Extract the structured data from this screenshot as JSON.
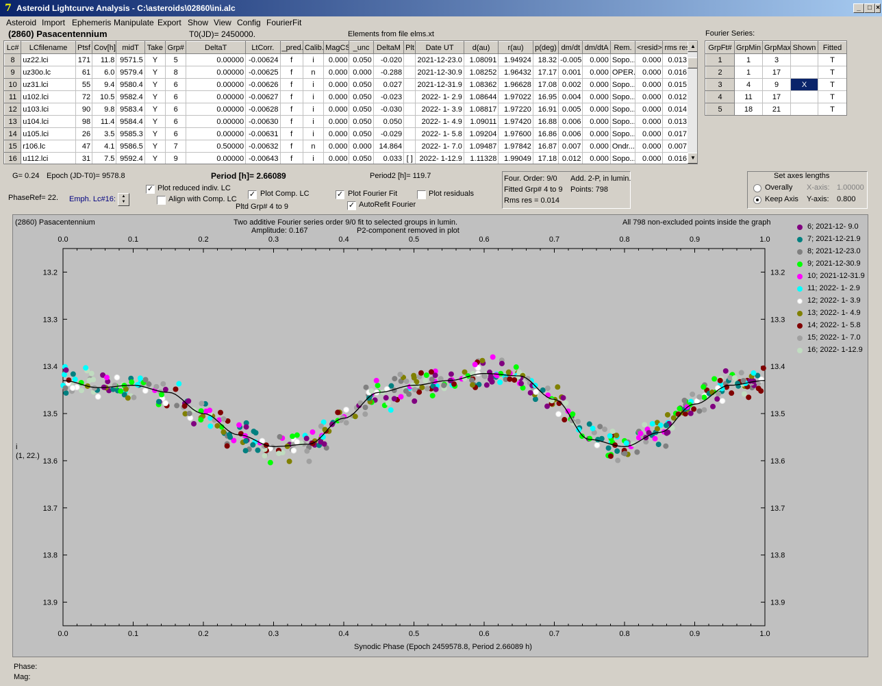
{
  "window": {
    "title": "Asteroid Lightcurve Analysis - C:\\asteroids\\02860\\ini.alc",
    "icon": "app-icon",
    "buttons": [
      "_",
      "□",
      "×"
    ]
  },
  "menu": [
    "Asteroid",
    "Import",
    "Ephemeris",
    "Manipulate",
    "Export",
    "Show",
    "View",
    "Config",
    "FourierFit"
  ],
  "header": {
    "asteroid": "(2860) Pasacentennium",
    "t0": "T0(JD)= 2450000.",
    "elements": "Elements from file elms.xt",
    "fourier_title": "Fourier Series:"
  },
  "lc_table": {
    "columns": [
      "Lc#",
      "LCfilename",
      "Ptsf",
      "Cov[h]",
      "midT",
      "Take",
      "Grp#",
      "DeltaT",
      "LtCorr.",
      "_pred.",
      "Calib.",
      "MagCS",
      "_unc",
      "DeltaM",
      "Plt",
      "Date UT",
      "d(au)",
      "r(au)",
      "p(deg)",
      "dm/dt",
      "dm/dtA",
      "Rem.",
      "<resid>",
      "rms res"
    ],
    "rows": [
      [
        "8",
        "uz22.lci",
        "171",
        "11.8",
        "9571.5",
        "Y",
        "5",
        "0.00000",
        "-0.00624",
        "f",
        "i",
        "0.000",
        "0.050",
        "-0.020",
        "",
        "2021-12-23.0",
        "1.08091",
        "1.94924",
        "18.32",
        "-0.005",
        "0.000",
        "Sopo...",
        "0.000",
        "0.013"
      ],
      [
        "9",
        "uz30o.lc",
        "61",
        "6.0",
        "9579.4",
        "Y",
        "8",
        "0.00000",
        "-0.00625",
        "f",
        "n",
        "0.000",
        "0.000",
        "-0.288",
        "",
        "2021-12-30.9",
        "1.08252",
        "1.96432",
        "17.17",
        "0.001",
        "0.000",
        "OPER.",
        "0.000",
        "0.016"
      ],
      [
        "10",
        "uz31.lci",
        "55",
        "9.4",
        "9580.4",
        "Y",
        "6",
        "0.00000",
        "-0.00626",
        "f",
        "i",
        "0.000",
        "0.050",
        "0.027",
        "",
        "2021-12-31.9",
        "1.08362",
        "1.96628",
        "17.08",
        "0.002",
        "0.000",
        "Sopo...",
        "0.000",
        "0.015"
      ],
      [
        "11",
        "u102.lci",
        "72",
        "10.5",
        "9582.4",
        "Y",
        "6",
        "0.00000",
        "-0.00627",
        "f",
        "i",
        "0.000",
        "0.050",
        "-0.023",
        "",
        "2022- 1- 2.9",
        "1.08644",
        "1.97022",
        "16.95",
        "0.004",
        "0.000",
        "Sopo...",
        "0.000",
        "0.012"
      ],
      [
        "12",
        "u103.lci",
        "90",
        "9.8",
        "9583.4",
        "Y",
        "6",
        "0.00000",
        "-0.00628",
        "f",
        "i",
        "0.000",
        "0.050",
        "-0.030",
        "",
        "2022- 1- 3.9",
        "1.08817",
        "1.97220",
        "16.91",
        "0.005",
        "0.000",
        "Sopo...",
        "0.000",
        "0.014"
      ],
      [
        "13",
        "u104.lci",
        "98",
        "11.4",
        "9584.4",
        "Y",
        "6",
        "0.00000",
        "-0.00630",
        "f",
        "i",
        "0.000",
        "0.050",
        "0.050",
        "",
        "2022- 1- 4.9",
        "1.09011",
        "1.97420",
        "16.88",
        "0.006",
        "0.000",
        "Sopo...",
        "0.000",
        "0.013"
      ],
      [
        "14",
        "u105.lci",
        "26",
        "3.5",
        "9585.3",
        "Y",
        "6",
        "0.00000",
        "-0.00631",
        "f",
        "i",
        "0.000",
        "0.050",
        "-0.029",
        "",
        "2022- 1- 5.8",
        "1.09204",
        "1.97600",
        "16.86",
        "0.006",
        "0.000",
        "Sopo...",
        "0.000",
        "0.017"
      ],
      [
        "15",
        "r106.lc",
        "47",
        "4.1",
        "9586.5",
        "Y",
        "7",
        "0.50000",
        "-0.00632",
        "f",
        "n",
        "0.000",
        "0.000",
        "14.864",
        "",
        "2022- 1- 7.0",
        "1.09487",
        "1.97842",
        "16.87",
        "0.007",
        "0.000",
        "Ondr...",
        "0.000",
        "0.007"
      ],
      [
        "16",
        "u112.lci",
        "31",
        "7.5",
        "9592.4",
        "Y",
        "9",
        "0.00000",
        "-0.00643",
        "f",
        "i",
        "0.000",
        "0.050",
        "0.033",
        "[ ]",
        "2022- 1-12.9",
        "1.11328",
        "1.99049",
        "17.18",
        "0.012",
        "0.000",
        "Sopo...",
        "0.000",
        "0.016"
      ]
    ]
  },
  "fourier_table": {
    "columns": [
      "GrpFt#",
      "GrpMin",
      "GrpMax",
      "Shown",
      "Fitted"
    ],
    "rows": [
      [
        "1",
        "1",
        "3",
        "",
        "T"
      ],
      [
        "2",
        "1",
        "17",
        "",
        "T"
      ],
      [
        "3",
        "4",
        "9",
        "X",
        "T"
      ],
      [
        "4",
        "11",
        "17",
        "",
        "T"
      ],
      [
        "5",
        "18",
        "21",
        "",
        "T"
      ]
    ]
  },
  "controls": {
    "g": "G= 0.24",
    "epoch": "Epoch (JD-T0)= 9578.8",
    "period": "Period [h]= 2.66089",
    "period2": "Period2 [h]= 119.7",
    "phaseref": "PhaseRef= 22.",
    "emph": "Emph. Lc#16:",
    "plot_reduced": "Plot reduced indiv. LC",
    "align": "Align with Comp. LC",
    "plot_comp": "Plot Comp. LC",
    "plotted_grp": "Pltd Grp#  4  to   9",
    "plot_fourier": "Plot Fourier Fit",
    "autorefit": "AutoRefit Fourier",
    "plot_resid": "Plot residuals",
    "four_order": "Four. Order:  9/0",
    "fitted_grp": "Fitted Grp# 4 to 9",
    "rms": "Rms res     = 0.014",
    "add2p": "Add. 2-P, in lumin.",
    "points": "Points: 798",
    "axes_title": "Set axes lengths",
    "overally": "Overally",
    "keep_axis": "Keep Axis",
    "xaxis_label": "X-axis:",
    "xaxis_val": "1.00000",
    "yaxis_label": "Y-axis:",
    "yaxis_val": "0.800"
  },
  "status": {
    "phase": "Phase:",
    "mag": "Mag:"
  },
  "chart_data": {
    "type": "scatter",
    "title_left": "(2860) Pasacentennium",
    "title": "Two additive Fourier series order 9/0 fit to selected groups in lumin.",
    "subtitle_amp": "Amplitude: 0.167",
    "subtitle_p2": "P2-component removed in plot",
    "title_right": "All 798 non-excluded points inside the graph",
    "xlabel": "Synodic Phase (Epoch 2459578.8, Period 2.66089 h)",
    "ylabel": "i",
    "ylabel2": "(1, 22.)",
    "xlim": [
      0,
      1
    ],
    "ylim": [
      13.15,
      13.95
    ],
    "y_inverted": true,
    "xticks": [
      "0.0",
      "0.1",
      "0.2",
      "0.3",
      "0.4",
      "0.5",
      "0.6",
      "0.7",
      "0.8",
      "0.9",
      "1.0"
    ],
    "yticks": [
      "13.2",
      "13.3",
      "13.4",
      "13.5",
      "13.6",
      "13.7",
      "13.8",
      "13.9"
    ],
    "fit_curve": {
      "x": [
        0,
        0.05,
        0.1,
        0.15,
        0.2,
        0.25,
        0.3,
        0.35,
        0.4,
        0.45,
        0.5,
        0.55,
        0.6,
        0.65,
        0.7,
        0.75,
        0.8,
        0.85,
        0.9,
        0.95,
        1.0
      ],
      "y": [
        13.43,
        13.445,
        13.44,
        13.455,
        13.5,
        13.545,
        13.57,
        13.565,
        13.51,
        13.455,
        13.44,
        13.43,
        13.415,
        13.42,
        13.47,
        13.555,
        13.57,
        13.54,
        13.48,
        13.44,
        13.43
      ]
    },
    "series": [
      {
        "name": "6; 2021-12- 9.0",
        "color": "#800080"
      },
      {
        "name": "7; 2021-12-21.9",
        "color": "#008080"
      },
      {
        "name": "8; 2021-12-23.0",
        "color": "#808080"
      },
      {
        "name": "9; 2021-12-30.9",
        "color": "#00ff00"
      },
      {
        "name": "10; 2021-12-31.9",
        "color": "#ff00ff"
      },
      {
        "name": "11; 2022- 1- 2.9",
        "color": "#00ffff"
      },
      {
        "name": "12; 2022- 1- 3.9",
        "color": "#ffffff"
      },
      {
        "name": "13; 2022- 1- 4.9",
        "color": "#808000"
      },
      {
        "name": "14; 2022- 1- 5.8",
        "color": "#800000"
      },
      {
        "name": "15; 2022- 1- 7.0",
        "color": "#a0a0a0"
      },
      {
        "name": "16; 2022- 1-12.9",
        "color": "#c0dcc0"
      }
    ]
  }
}
